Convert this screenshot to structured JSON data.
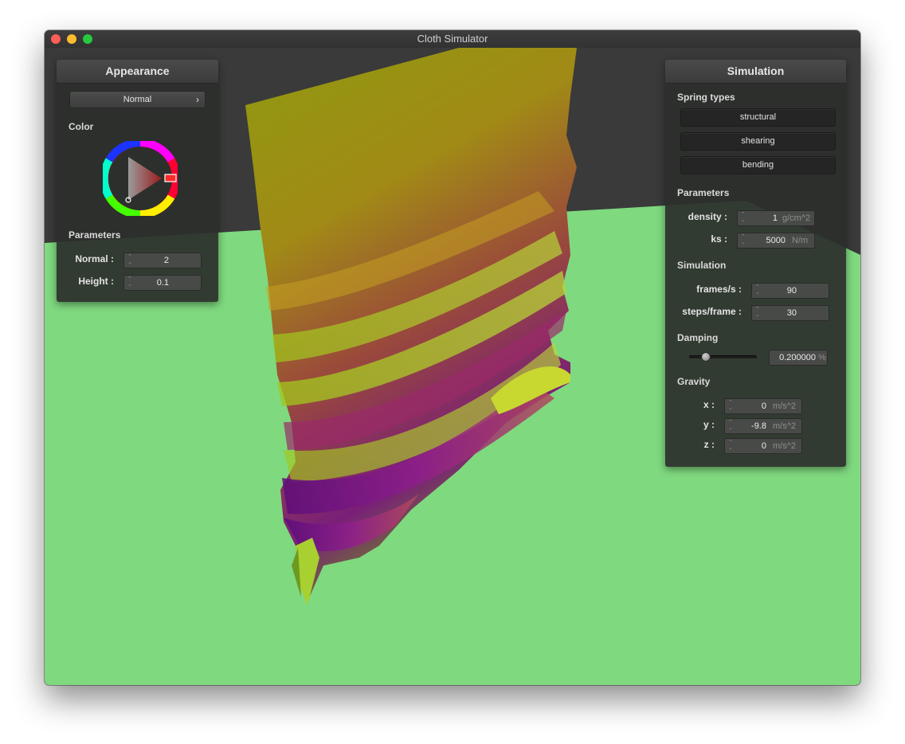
{
  "window": {
    "title": "Cloth Simulator"
  },
  "appearance": {
    "title": "Appearance",
    "shader": {
      "selected": "Normal",
      "chevron": "›"
    },
    "color_label": "Color",
    "params_label": "Parameters",
    "normal": {
      "label": "Normal :",
      "value": "2"
    },
    "height": {
      "label": "Height :",
      "value": "0.1"
    }
  },
  "simulation": {
    "title": "Simulation",
    "spring_types_label": "Spring types",
    "springs": [
      "structural",
      "shearing",
      "bending"
    ],
    "params_label": "Parameters",
    "density": {
      "label": "density :",
      "value": "1",
      "unit": "g/cm^2"
    },
    "ks": {
      "label": "ks :",
      "value": "5000",
      "unit": "N/m"
    },
    "sim_label": "Simulation",
    "fps": {
      "label": "frames/s :",
      "value": "90"
    },
    "steps": {
      "label": "steps/frame :",
      "value": "30"
    },
    "damping_label": "Damping",
    "damping": {
      "value": "0.200000",
      "unit": "%",
      "fraction": 0.2
    },
    "gravity_label": "Gravity",
    "gx": {
      "label": "x :",
      "value": "0",
      "unit": "m/s^2"
    },
    "gy": {
      "label": "y :",
      "value": "-9.8",
      "unit": "m/s^2"
    },
    "gz": {
      "label": "z :",
      "value": "0",
      "unit": "m/s^2"
    }
  },
  "colors": {
    "floor": "#7fd97f",
    "background": "#3a3a3a",
    "cloth_green": "#8cbf10",
    "cloth_purple": "#8a1a8a"
  }
}
